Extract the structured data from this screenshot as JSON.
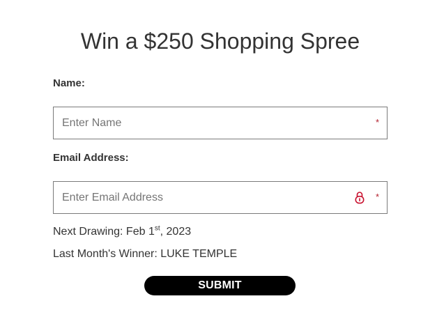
{
  "form": {
    "title": "Win a $250 Shopping Spree",
    "name_label": "Name:",
    "name_placeholder": "Enter Name",
    "name_value": "",
    "email_label": "Email Address:",
    "email_placeholder": "Enter Email Address",
    "email_value": "",
    "required_marker": "*",
    "lock_icon": "lock-icon",
    "submit_label": "SUBMIT"
  },
  "info": {
    "drawing_prefix": "Next Drawing: Feb 1",
    "drawing_suffix": "st",
    "drawing_year": ", 2023",
    "winner_text": "Last Month's Winner: LUKE TEMPLE"
  },
  "colors": {
    "required_star": "#b3202e",
    "lock_icon": "#c8102e",
    "button_bg": "#000000",
    "button_text": "#ffffff",
    "field_border": "#7a7a7a",
    "text": "#333333"
  }
}
